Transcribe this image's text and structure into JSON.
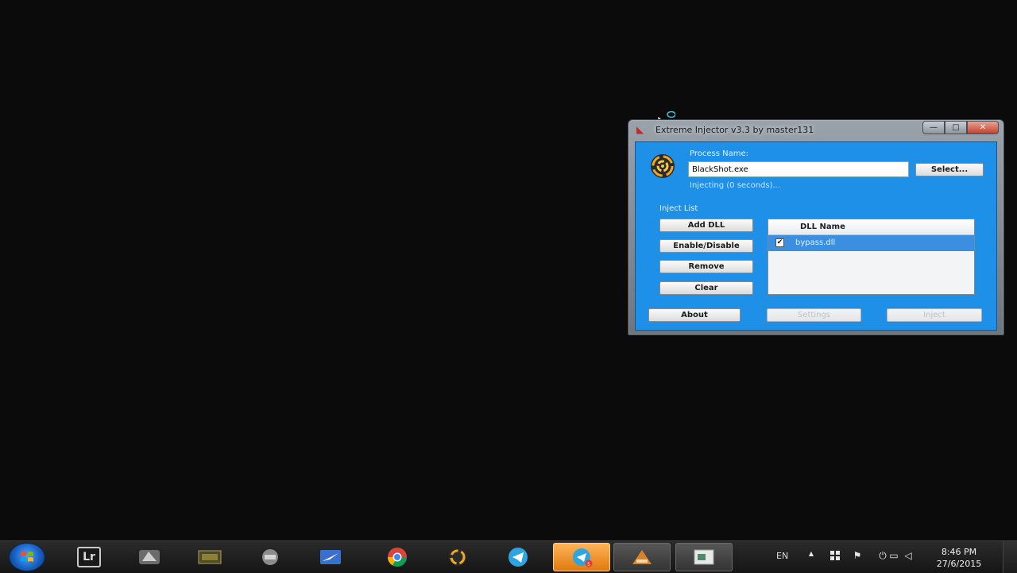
{
  "window": {
    "title": "Extreme Injector v3.3 by master131",
    "controls": {
      "minimize": "—",
      "maximize": "□",
      "close": "✕"
    }
  },
  "process": {
    "label": "Process Name:",
    "value": "BlackShot.exe",
    "select_label": "Select...",
    "status": "Injecting (0 seconds)..."
  },
  "inject_list": {
    "label": "Inject List",
    "buttons": {
      "add": "Add DLL",
      "toggle": "Enable/Disable",
      "remove": "Remove",
      "clear": "Clear"
    },
    "column_header": "DLL Name",
    "items": [
      {
        "name": "bypass.dll",
        "checked": "✔"
      }
    ]
  },
  "footer": {
    "about": "About",
    "settings": "Settings",
    "inject": "Inject"
  },
  "taskbar": {
    "lightroom_label": "Lr",
    "language": "EN",
    "tray": {
      "arrow": "▲",
      "flag": "⚑",
      "power": "⏻",
      "network": "▭",
      "volume": "◁"
    },
    "time": "8:46 PM",
    "date": "27/6/2015",
    "telegram_badge": "5"
  },
  "colors": {
    "client_bg": "#1e90e8",
    "taskbar_active": "#f0901e"
  }
}
